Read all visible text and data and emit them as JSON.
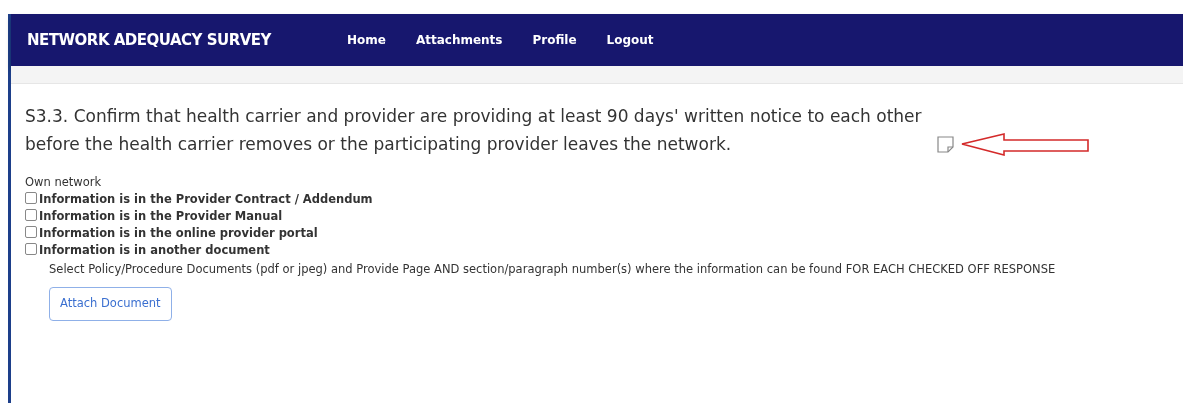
{
  "navbar": {
    "brand": "NETWORK ADEQUACY SURVEY",
    "links": [
      {
        "label": "Home"
      },
      {
        "label": "Attachments"
      },
      {
        "label": "Profile"
      },
      {
        "label": "Logout"
      }
    ]
  },
  "question": {
    "text": "S3.3. Confirm that health carrier and provider are providing at least 90 days' written notice to each other before the health carrier removes or the participating provider leaves the network."
  },
  "group_label": "Own network",
  "options": [
    {
      "label": "Information is in the Provider Contract / Addendum",
      "checked": false
    },
    {
      "label": "Information is in the Provider Manual",
      "checked": false
    },
    {
      "label": "Information is in the online provider portal",
      "checked": false
    },
    {
      "label": "Information is in another document",
      "checked": false
    }
  ],
  "instructions": "Select Policy/Procedure Documents (pdf or jpeg) and Provide Page AND section/paragraph number(s) where the information can be found FOR EACH CHECKED OFF RESPONSE",
  "attach_button": "Attach Document"
}
